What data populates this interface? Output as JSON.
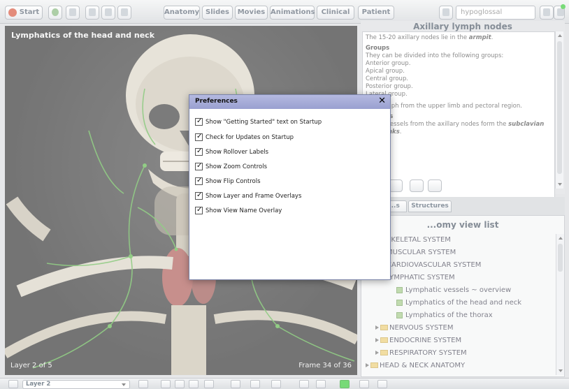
{
  "toolbar": {
    "start_label": "Start",
    "tabs": [
      {
        "label": "Anatomy"
      },
      {
        "label": "Slides"
      },
      {
        "label": "Movies"
      },
      {
        "label": "Animations"
      },
      {
        "label": "Clinical"
      },
      {
        "label": "Patient"
      }
    ],
    "search_value": "hypoglossal"
  },
  "view": {
    "title": "Lymphatics of the head and neck",
    "layer_overlay": "Layer 2 of 5",
    "frame_overlay": "Frame 34 of 36"
  },
  "info": {
    "title": "Axillary lymph nodes",
    "intro_pre": "The 15-20 axillary nodes lie in the ",
    "intro_em": "armpit",
    "groups_heading": "Groups",
    "groups_intro": "They can be divided into the following groups:",
    "groups": [
      "Anterior group.",
      "Apical group.",
      "Central group.",
      "Posterior group.",
      "Lateral group."
    ],
    "receive_text": "...ve lymph from the upper limb and pectoral region.",
    "vessels_heading": "...essels",
    "vessels_text_pre": "...mph vessels from the axillary nodes form the ",
    "vessels_em": "subclavian",
    "vessels_text_post": "...c trunks"
  },
  "tabs_right": [
    {
      "label": "...s"
    },
    {
      "label": "Structures"
    }
  ],
  "list": {
    "title": "...omy view list",
    "items": [
      {
        "label": "SKELETAL SYSTEM",
        "type": "folder"
      },
      {
        "label": "MUSCULAR SYSTEM",
        "type": "folder"
      },
      {
        "label": "CARDIOVASCULAR SYSTEM",
        "type": "folder"
      },
      {
        "label": "LYMPHATIC SYSTEM",
        "type": "folder"
      },
      {
        "label": "Lymphatic vessels ~ overview",
        "type": "leaf"
      },
      {
        "label": "Lymphatics of the head and neck",
        "type": "leaf"
      },
      {
        "label": "Lymphatics of the thorax",
        "type": "leaf"
      },
      {
        "label": "NERVOUS SYSTEM",
        "type": "folder"
      },
      {
        "label": "ENDOCRINE SYSTEM",
        "type": "folder"
      },
      {
        "label": "RESPIRATORY SYSTEM",
        "type": "folder"
      },
      {
        "label": "HEAD & NECK ANATOMY",
        "type": "folder"
      }
    ]
  },
  "bottom": {
    "layer_select_value": "Layer 2"
  },
  "preferences": {
    "title": "Preferences",
    "close_glyph": "✕",
    "options": [
      {
        "label": "Show \"Getting Started\" text on Startup",
        "checked": true
      },
      {
        "label": "Check for Updates on Startup",
        "checked": true
      },
      {
        "label": "Show Rollover Labels",
        "checked": true
      },
      {
        "label": "Show Zoom Controls",
        "checked": true
      },
      {
        "label": "Show Flip Controls",
        "checked": true
      },
      {
        "label": "Show Layer and Frame Overlays",
        "checked": true
      },
      {
        "label": "Show View Name Overlay",
        "checked": true
      }
    ]
  },
  "colors": {
    "accent": "#9aa0d0",
    "lymph_green": "#4fae3b",
    "status_green": "#26c526"
  }
}
